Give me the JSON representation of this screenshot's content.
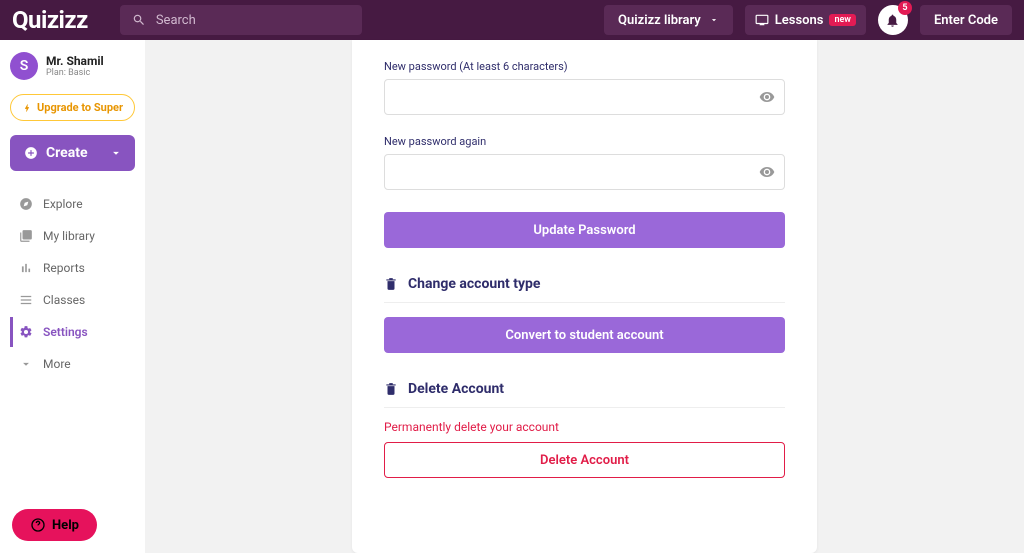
{
  "topbar": {
    "logo": "Quizizz",
    "search_placeholder": "Search",
    "library_label": "Quizizz library",
    "lessons_label": "Lessons",
    "lessons_badge": "new",
    "notif_count": "5",
    "enter_code": "Enter Code"
  },
  "sidebar": {
    "avatar_initial": "S",
    "user_name": "Mr. Shamil",
    "user_plan": "Plan: Basic",
    "upgrade_label": "Upgrade to Super",
    "create_label": "Create",
    "nav": {
      "explore": "Explore",
      "my_library": "My library",
      "reports": "Reports",
      "classes": "Classes",
      "settings": "Settings",
      "more": "More"
    },
    "help_label": "Help"
  },
  "settings": {
    "new_password_label": "New password (At least 6 characters)",
    "new_password_again_label": "New password again",
    "update_password_btn": "Update Password",
    "change_type_heading": "Change account type",
    "convert_btn": "Convert to student account",
    "delete_heading": "Delete Account",
    "delete_warn": "Permanently delete your account",
    "delete_btn": "Delete Account"
  }
}
